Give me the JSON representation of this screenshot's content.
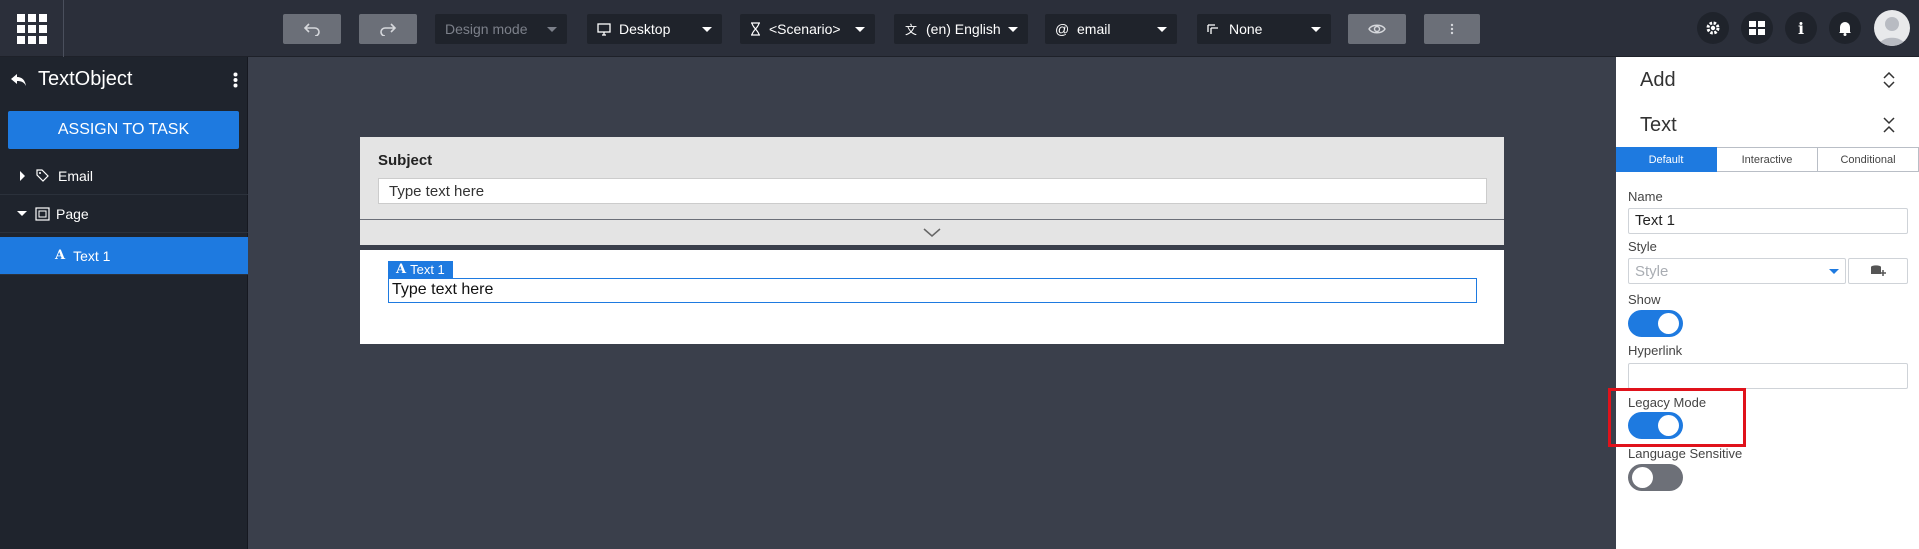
{
  "toolbar": {
    "undo_icon": "undo-icon",
    "redo_icon": "redo-icon",
    "design_mode": "Design mode",
    "device": "Desktop",
    "scenario": "<Scenario>",
    "language": "(en) English",
    "channel": "email",
    "filter": "None",
    "preview_icon": "eye-icon",
    "more_icon": "more-vertical-icon",
    "right_icons": [
      "gear-icon",
      "layout-icon",
      "info-icon",
      "bell-icon",
      "avatar"
    ]
  },
  "left_panel": {
    "title": "TextObject",
    "assign_button": "ASSIGN TO TASK",
    "tree": [
      {
        "label": "Email",
        "expanded": false
      },
      {
        "label": "Page",
        "expanded": true
      },
      {
        "label": "Text 1",
        "selected": true
      }
    ]
  },
  "canvas": {
    "subject_label": "Subject",
    "subject_placeholder": "Type text here",
    "text1_tag": "Text 1",
    "text1_value": "Type text here"
  },
  "right_panel": {
    "add_title": "Add",
    "text_title": "Text",
    "tabs": [
      "Default",
      "Interactive",
      "Conditional"
    ],
    "active_tab": "Default",
    "name_label": "Name",
    "name_value": "Text 1",
    "style_label": "Style",
    "style_placeholder": "Style",
    "show_label": "Show",
    "show_on": true,
    "hyperlink_label": "Hyperlink",
    "hyperlink_value": "",
    "legacy_label": "Legacy Mode",
    "legacy_on": true,
    "language_label": "Language Sensitive",
    "language_on": false
  },
  "colors": {
    "accent": "#1e7ae0",
    "highlight": "#e0121b",
    "topbar": "#2b2f3a",
    "canvas": "#3a3f4b"
  }
}
